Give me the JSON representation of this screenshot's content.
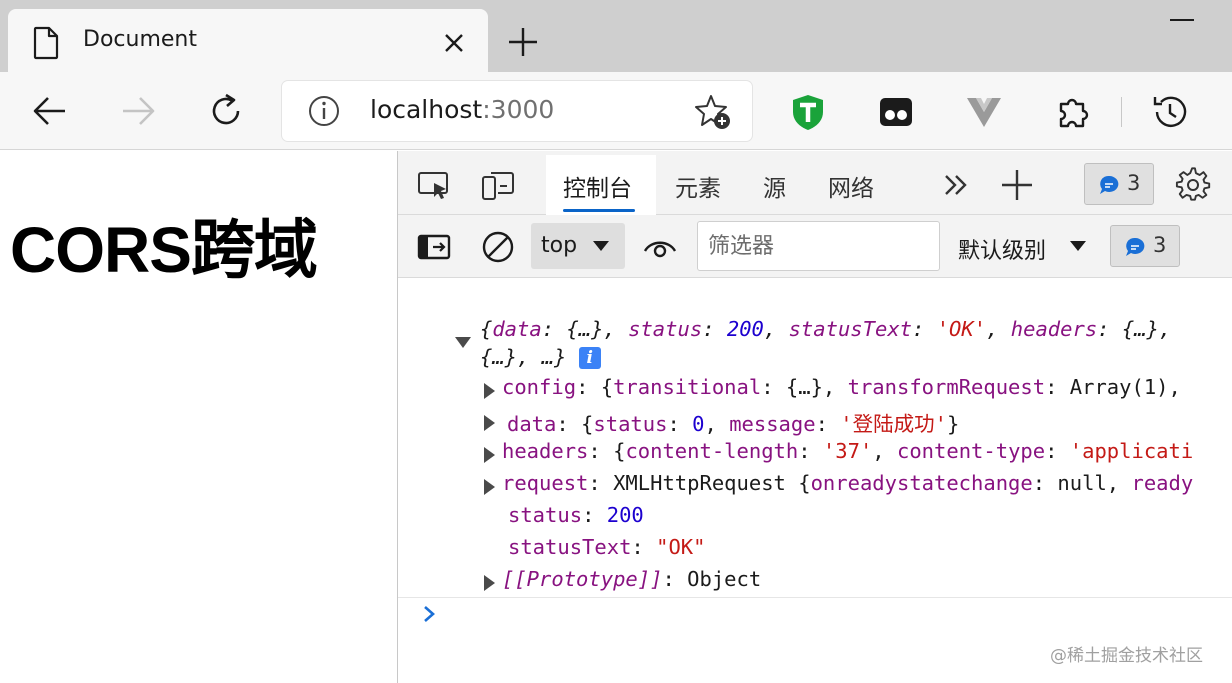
{
  "browser": {
    "tab": {
      "title": "Document"
    },
    "address": {
      "host": "localhost",
      "port": ":3000"
    }
  },
  "page": {
    "heading": "CORS跨域"
  },
  "devtools": {
    "tabs": [
      "控制台",
      "元素",
      "源",
      "网络"
    ],
    "issues_count": "3",
    "context": "top",
    "filter_placeholder": "筛选器",
    "level": "默认级别",
    "messages_count": "3",
    "console": {
      "summary_line1": [
        [
          "{",
          "sump"
        ],
        [
          "data",
          "sumk"
        ],
        [
          ": {…}, ",
          "sump"
        ],
        [
          "status",
          "sumk"
        ],
        [
          ": ",
          "sump"
        ],
        [
          "200",
          "sumn"
        ],
        [
          ", ",
          "sump"
        ],
        [
          "statusText",
          "sumk"
        ],
        [
          ": ",
          "sump"
        ],
        [
          "'OK'",
          "sums"
        ],
        [
          ", ",
          "sump"
        ],
        [
          "headers",
          "sumk"
        ],
        [
          ": {…},",
          "sump"
        ]
      ],
      "summary_line2": "{…}, …}",
      "rows": [
        {
          "expand": true,
          "parts": [
            [
              "config",
              "k"
            ],
            [
              ": {",
              "p"
            ],
            [
              "transitional",
              "k"
            ],
            [
              ": {…}, ",
              "p"
            ],
            [
              "transformRequest",
              "k"
            ],
            [
              ": Array(1),",
              "p"
            ]
          ]
        },
        {
          "expand": true,
          "parts": [
            [
              "data",
              "k"
            ],
            [
              ": {",
              "p"
            ],
            [
              "status",
              "k"
            ],
            [
              ": ",
              "p"
            ],
            [
              "0",
              "n"
            ],
            [
              ", ",
              "p"
            ],
            [
              "message",
              "k"
            ],
            [
              ": ",
              "p"
            ],
            [
              "'登陆成功'",
              "s"
            ],
            [
              "}",
              "p"
            ]
          ]
        },
        {
          "expand": true,
          "parts": [
            [
              "headers",
              "k"
            ],
            [
              ": {",
              "p"
            ],
            [
              "content-length",
              "k"
            ],
            [
              ": ",
              "p"
            ],
            [
              "'37'",
              "s"
            ],
            [
              ", ",
              "p"
            ],
            [
              "content-type",
              "k"
            ],
            [
              ": ",
              "p"
            ],
            [
              "'applicati",
              "s"
            ]
          ]
        },
        {
          "expand": true,
          "parts": [
            [
              "request",
              "k"
            ],
            [
              ": XMLHttpRequest {",
              "p"
            ],
            [
              "onreadystatechange",
              "k"
            ],
            [
              ": null, ",
              "p"
            ],
            [
              "ready",
              "k"
            ]
          ]
        },
        {
          "expand": false,
          "parts": [
            [
              "status",
              "k"
            ],
            [
              ": ",
              "p"
            ],
            [
              "200",
              "n"
            ]
          ]
        },
        {
          "expand": false,
          "parts": [
            [
              "statusText",
              "k"
            ],
            [
              ": ",
              "p"
            ],
            [
              "\"OK\"",
              "s"
            ]
          ]
        },
        {
          "expand": true,
          "parts": [
            [
              "[[Prototype]]",
              "sumk"
            ],
            [
              ": Object",
              "p"
            ]
          ]
        }
      ]
    }
  },
  "watermark": "@稀土掘金技术社区",
  "colors": {
    "accent": "#0a64c8",
    "badge_blue": "#3b82f6",
    "key": "#881280",
    "string": "#c41a16",
    "number": "#1c00cf"
  },
  "icons": [
    "document-icon",
    "close-icon",
    "plus-icon",
    "back-arrow-icon",
    "forward-arrow-icon",
    "refresh-icon",
    "info-icon",
    "favorite-star-icon",
    "shield-t-extension-icon",
    "mask-extension-icon",
    "vue-extension-icon",
    "puzzle-extensions-icon",
    "history-icon",
    "inspect-icon",
    "device-icon",
    "chevrons-icon",
    "gear-icon",
    "sidebar-icon",
    "clear-icon",
    "eye-icon",
    "chat-icon"
  ]
}
